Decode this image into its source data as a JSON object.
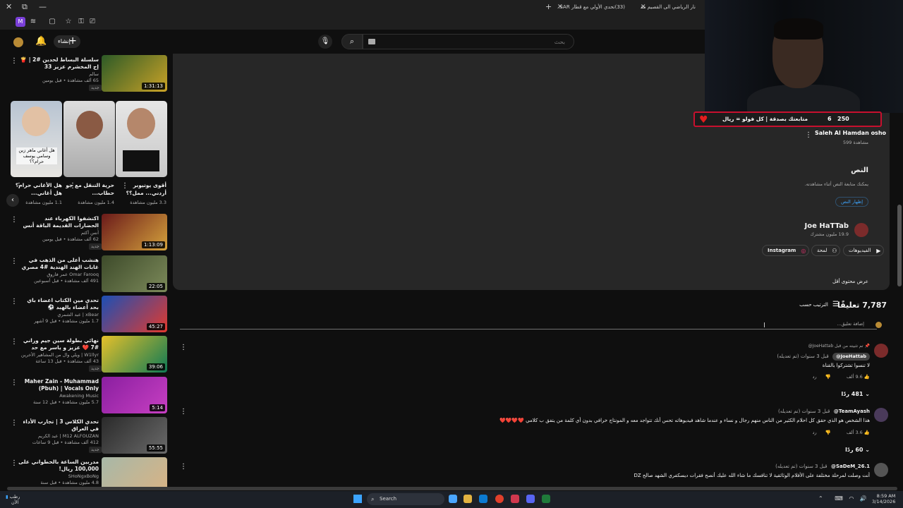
{
  "browser": {
    "tabs": [
      {
        "label": "نار الرياضي الى القصيم مقصي..."
      },
      {
        "label": "(33)تحدي الأولي مع قطار SAR..."
      }
    ]
  },
  "header": {
    "search_placeholder": "بحث",
    "create_label": "إنشاء"
  },
  "recs": [
    {
      "title": "سلسلة البساط لحدين #2 | 🍟 إج المخشرم عزيز 33",
      "channel": "سالم",
      "meta": "65 ألف مشاهدة • قبل يومين",
      "duration": "1:31:13",
      "badge": "جديد"
    },
    {
      "title": "اكتشفوا الكهرباء عند الحضارات القديمة الباقة أنس أكثم",
      "channel": "أنس أكثم",
      "meta": "62 ألف مشاهدة • قبل يومين",
      "duration": "1:13:09",
      "badge": "جديد"
    },
    {
      "title": "هنشب أعلى من الذهب في غابات الهند الهندية #4 مصري مع حرب",
      "channel": "Omar Farooq عمر فاروق",
      "meta": "491 ألف مشاهدة • قبل أسبوعين",
      "duration": "22:05",
      "badge": ""
    },
    {
      "title": "تحدي مين الكتاب اعضاء باي بحد أعضاء بالهبد ⚽",
      "channel": "xBear | عبد الشمري",
      "meta": "1.7 مليون مشاهدة • قبل 9 أشهر",
      "duration": "45:27",
      "badge": ""
    },
    {
      "title": "نهائي بطولة سين جيم وراني #7 ❤️ عزيز و ياسر مع حد كويتك",
      "channel": "W1llyr | ويلي وال من المشاهير الأخرين",
      "meta": "43 ألف مشاهدة • قبل 13 ساعة",
      "duration": "39:06",
      "badge": "جديد"
    },
    {
      "title": "Maher Zain - Muhammad (Pbuh) | Vocals Only (Lyrics)",
      "channel": "Awakening Music",
      "meta": "5.7 مليون مشاهدة • قبل 12 سنة",
      "duration": "5:14",
      "badge": ""
    },
    {
      "title": "تحدي الكلاس 3 | تجارب الأداء في العراق",
      "channel": "M12 ALFOUZAN | عبد الكريم",
      "meta": "412 ألف مشاهدة • قبل 9 ساعات",
      "duration": "55:55",
      "badge": "جديد"
    },
    {
      "title": "مدربين الساعة بالحطواني على 100,000 ريال!",
      "channel": "SHoNgxBoNg",
      "meta": "4.8 مليون مشاهدة • قبل سنة",
      "duration": "",
      "badge": ""
    }
  ],
  "shorts": [
    {
      "title": "أقوى يوتيوبر أردني... ممل؟؟",
      "views": "3.3 مليون مشاهدة"
    },
    {
      "title": "حرية التنقل مع جو حطاب...",
      "views": "1.4 مليون مشاهدة"
    },
    {
      "title": "هل الأغاني حرام؟ هل أغاني...",
      "views": "1.1 مليون مشاهدة"
    }
  ],
  "short_captions": [
    "هل أغاني ماهر زين وسامي يوسف حرام؟؟"
  ],
  "description": {
    "transcript_title": "النص",
    "transcript_sub": "يمكنك متابعة النص أثناء مشاهدته.",
    "transcript_btn": "إظهار النص",
    "channel_name": "Joe HaTTab",
    "channel_subs": "19.9 مليون مشترك",
    "links": [
      {
        "label": "الفيديوهات"
      },
      {
        "label": "لمحة"
      },
      {
        "label": "Instagram"
      }
    ],
    "show_less": "عرض محتوى أقل",
    "partial_name": "Saleh Al Hamdan osho",
    "partial_views": "599 مشاهدة"
  },
  "comments_header": {
    "count": "7,787 تعليقًا",
    "sort": "الترتيب حسب",
    "add_placeholder": "إضافة تعليق..."
  },
  "comments": [
    {
      "pinned": "تم تثبيته من قبل JoeHattab@",
      "author": "JoeHattab@",
      "time": "قبل 3 سنوات (تم تعديله)",
      "text": "لا تنسوا تشتركوا بالقناة",
      "likes": "9.6 ألف",
      "reply": "رد",
      "replies": "481 ردًا"
    },
    {
      "pinned": "",
      "author": "TeamAyash@",
      "time": "قبل 3 سنوات (تم تعديله)",
      "text": "هذا الشخص هو الذي حقق كل احلام الكثير من الناس منهم رجال و نساء و عندما شاهد فيديوهاته تحس أنك تتواجد معه و المونتاج خرافي بدون أي كلمة من يتفق ب كلامي",
      "likes": "3.6 ألف",
      "reply": "رد",
      "replies": "60 ردًا"
    },
    {
      "pinned": "",
      "author": "SaDeM_26.1@",
      "time": "قبل 3 سنوات (تم تعديله)",
      "text": "أنت وصلت لمرحلة مختلفة على الأفلام الوثائقية لا تنافسك ما شاء الله عليك أنصح فقرات ديسكفري الشهد صالح DZ",
      "likes": "",
      "reply": "",
      "replies": ""
    }
  ],
  "alert": {
    "text": "متابعتك بصدقة | كل فولو = ريال",
    "count": "6",
    "goal": "250"
  },
  "taskbar": {
    "search": "Search",
    "weather_line1": "رطب",
    "weather_line2": "الآن",
    "time": "8:59 AM",
    "date": "3/14/2026"
  }
}
